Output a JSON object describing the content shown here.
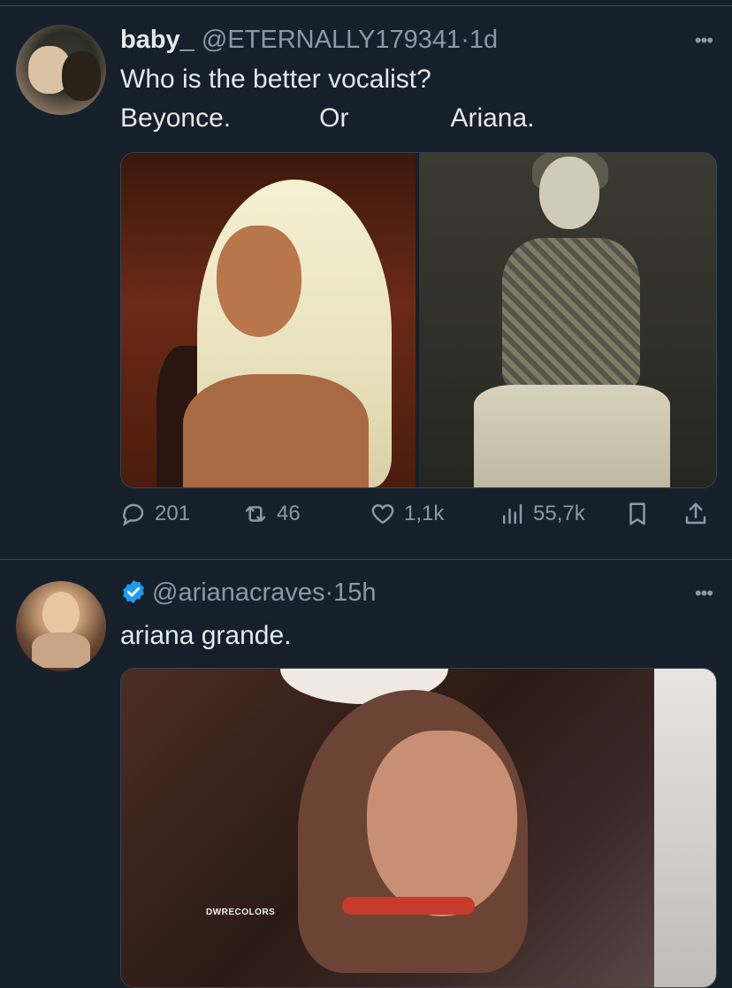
{
  "tweets": [
    {
      "author": {
        "display_name": "baby_",
        "handle": "@ETERNALLY179341",
        "time": "1d",
        "verified": false
      },
      "text_lines": [
        "Who is the better vocalist?",
        "Beyonce.            Or              Ariana."
      ],
      "media": [
        "photo-beyonce",
        "photo-ariana-bw"
      ],
      "stats": {
        "replies": "201",
        "retweets": "46",
        "likes": "1,1k",
        "views": "55,7k"
      }
    },
    {
      "author": {
        "display_name": "",
        "handle": "@arianacraves",
        "time": "15h",
        "verified": true
      },
      "text_lines": [
        "ariana grande."
      ],
      "media": [
        "photo-ariana-color"
      ],
      "watermark": "DWRECOLORS"
    }
  ],
  "ui": {
    "separator": "·",
    "more_label": "•••"
  },
  "icons": {
    "reply": "speech-bubble-icon",
    "retweet": "retweet-arrows-icon",
    "like": "heart-icon",
    "views": "bar-chart-icon",
    "bookmark": "bookmark-icon",
    "share": "share-arrow-icon",
    "verified": "verified-badge-icon"
  },
  "colors": {
    "background": "#15202b",
    "text": "#e7e9ea",
    "secondary": "#8b98a5",
    "accent": "#1d9bf0",
    "divider": "#38444d"
  }
}
